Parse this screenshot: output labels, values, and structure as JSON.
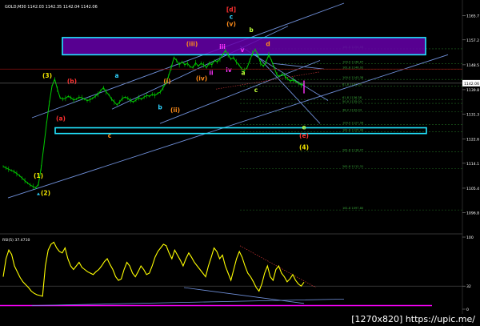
{
  "chart_data": {
    "type": "line",
    "title": "GOLD,M30  1142.03 1142.35 1142.04 1142.06",
    "symbol": "GOLD,M30",
    "ohlc": {
      "open": 1142.03,
      "high": 1142.35,
      "low": 1142.04,
      "close": 1142.06
    },
    "price_axis": {
      "ylim": [
        1090,
        1170
      ],
      "ticks": [
        1165.7,
        1157.2,
        1148.5,
        1139.8,
        1131.3,
        1122.6,
        1114.1,
        1105.4,
        1096.8
      ],
      "current_price": 1142.06,
      "red_level": 1147.0
    },
    "price_series": {
      "name": "GOLD M30 close",
      "values": [
        1113.0,
        1112.5,
        1112.0,
        1111.6,
        1111.2,
        1110.5,
        1109.8,
        1108.9,
        1108.0,
        1107.2,
        1106.5,
        1106.0,
        1105.5,
        1106.8,
        1112.5,
        1120.0,
        1128.0,
        1135.0,
        1141.0,
        1143.5,
        1140.0,
        1137.0,
        1136.5,
        1136.8,
        1137.5,
        1137.0,
        1136.2,
        1136.5,
        1137.2,
        1137.0,
        1136.5,
        1136.0,
        1136.3,
        1136.8,
        1137.5,
        1138.2,
        1139.5,
        1140.5,
        1139.0,
        1138.0,
        1136.5,
        1135.5,
        1134.5,
        1135.5,
        1136.8,
        1137.2,
        1136.8,
        1136.0,
        1135.5,
        1136.2,
        1137.0,
        1136.5,
        1137.2,
        1137.8,
        1137.5,
        1138.2,
        1137.8,
        1138.5,
        1139.0,
        1140.5,
        1142.0,
        1144.5,
        1147.5,
        1151.0,
        1150.0,
        1148.5,
        1149.5,
        1148.5,
        1149.0,
        1147.8,
        1147.5,
        1149.2,
        1148.0,
        1149.0,
        1148.5,
        1147.5,
        1149.0,
        1148.5,
        1150.0,
        1149.5,
        1150.5,
        1152.0,
        1153.5,
        1152.0,
        1150.5,
        1151.0,
        1149.5,
        1148.5,
        1147.0,
        1146.5,
        1147.5,
        1150.0,
        1152.5,
        1153.8,
        1152.0,
        1149.0,
        1148.0,
        1149.5,
        1152.0,
        1150.0,
        1147.5,
        1145.0,
        1144.5,
        1145.2,
        1144.5,
        1143.5,
        1142.8,
        1143.2,
        1142.6,
        1142.0,
        1141.4,
        1142.06
      ]
    },
    "rsi": {
      "label": "RSI(5) 37.4710",
      "period": 5,
      "value": 37.471,
      "ylim": [
        0,
        100
      ],
      "ticks": [
        100,
        32,
        0
      ],
      "values": [
        45,
        70,
        82,
        76,
        60,
        52,
        44,
        38,
        34,
        30,
        25,
        22,
        20,
        19,
        18,
        60,
        82,
        90,
        93,
        85,
        80,
        78,
        85,
        70,
        60,
        55,
        60,
        65,
        58,
        55,
        52,
        50,
        48,
        52,
        55,
        60,
        66,
        70,
        62,
        55,
        45,
        40,
        42,
        55,
        65,
        60,
        50,
        45,
        52,
        60,
        55,
        48,
        50,
        60,
        72,
        80,
        85,
        90,
        88,
        78,
        70,
        82,
        75,
        68,
        60,
        70,
        78,
        72,
        65,
        60,
        55,
        50,
        45,
        60,
        72,
        85,
        80,
        70,
        75,
        60,
        50,
        40,
        55,
        70,
        80,
        72,
        60,
        50,
        45,
        38,
        30,
        25,
        35,
        50,
        60,
        45,
        40,
        55,
        60,
        50,
        45,
        38,
        42,
        48,
        40,
        35,
        32,
        37.47
      ]
    },
    "wave_labels": [
      "(1)",
      "(2)",
      "(3)",
      "(b)",
      "(a)",
      "c",
      "a",
      "b",
      "(ii)",
      "(i)",
      "(iv)",
      "(iii)",
      "iii",
      "iv",
      "ii",
      "(v)",
      "[d]",
      "c",
      "b",
      "d",
      "a",
      "v",
      "c",
      "e",
      "(e)",
      "(4)"
    ],
    "fib_labels": [
      "161.8 1154.08",
      "100.0 1148.87",
      "161.8 1146.92",
      "100.0 1143.38",
      "61.8 1141.00",
      "61.8 1136.38",
      "50.0 1135.03",
      "38.2 1132.03",
      "100.0 1127.56",
      "161.8 1125.08",
      "261.8 1118.07",
      "261.8 1112.31",
      "161.8 1097.80"
    ],
    "grid": false,
    "legend_position": "top-left"
  },
  "watermark": "[1270x820] https://upic.me/",
  "colors": {
    "background": "#000000",
    "price": "#00cc00",
    "price_axis": "#ffffff",
    "channel": "#6f8fd8",
    "zone_fill": "#6600aa",
    "zone_border": "#22e5ff",
    "rsi_line": "#ffff00",
    "rsi_level": "#ff00ff",
    "fib": "#1f6a1f",
    "wave_orange": "#ff8c1a",
    "wave_yellow": "#f2e600",
    "wave_cyan": "#2ed3ff",
    "wave_red": "#ff3030",
    "wave_magenta": "#ff33ff",
    "wave_lime": "#c0ff3a"
  }
}
